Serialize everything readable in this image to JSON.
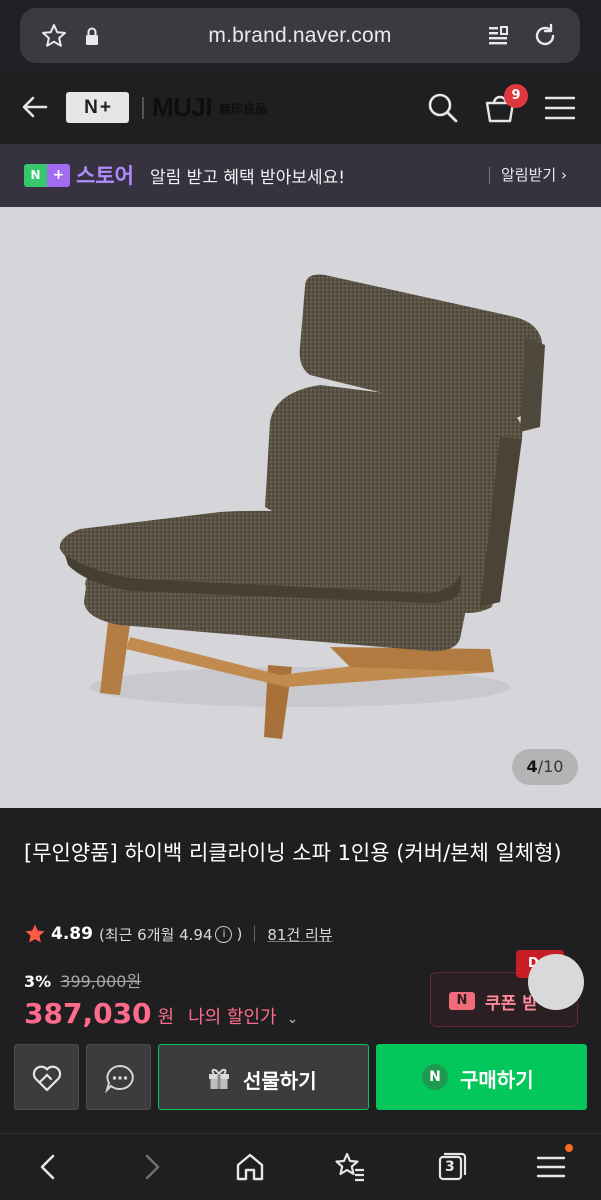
{
  "browser": {
    "url": "m.brand.naver.com",
    "icons": [
      "star-icon",
      "lock-icon",
      "reader-icon",
      "reload-icon"
    ]
  },
  "header": {
    "back_icon": "arrow-left-icon",
    "logo_text_n": "N",
    "logo_text_plus": "+",
    "brand_name": "MUJI",
    "brand_kanji": "無印良品",
    "cart_count": "9",
    "icons": [
      "search-icon",
      "cart-icon",
      "menu-icon"
    ]
  },
  "store_banner": {
    "logo_n": "N",
    "logo_plus": "+",
    "title": "스토어",
    "message": "알림 받고 혜택 받아보세요!",
    "cta": "알림받기",
    "cta_chevron": "›"
  },
  "gallery": {
    "current": "4",
    "separator": "/",
    "total": "10"
  },
  "product": {
    "title": "[무인양품] 하이백 리클라이닝 소파 1인용 (커버/본체 일체형)",
    "rating": "4.89",
    "recent_prefix": "(최근 6개월 4.94",
    "recent_suffix": ")",
    "info_glyph": "i",
    "reviews": "81건 리뷰",
    "discount_pct": "3%",
    "original_price": "399,000원",
    "price": "387,030",
    "price_unit": "원",
    "my_discount": "나의 할인가",
    "my_discount_chevron": "⌄"
  },
  "coupon": {
    "badge": "N",
    "label": "쿠폰 받",
    "flag": "D"
  },
  "actions": {
    "gift_label": "선물하기",
    "buy_label": "구매하기",
    "buy_badge": "N",
    "colors": {
      "buy": "#03c75a",
      "price": "#ff6b8b"
    }
  },
  "bottom_nav": {
    "tab_count": "3",
    "icons": [
      "back-icon",
      "forward-icon",
      "home-icon",
      "bookmarks-icon",
      "tabs-icon",
      "menu-icon"
    ]
  }
}
